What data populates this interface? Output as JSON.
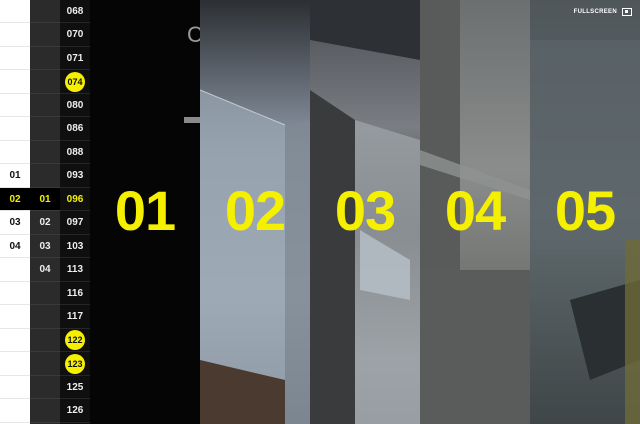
{
  "fullscreen": {
    "label": "FULLSCREEN",
    "icon": "fullscreen-icon"
  },
  "partial_heading": "C",
  "column_a": {
    "items": [
      {
        "label": ""
      },
      {
        "label": ""
      },
      {
        "label": ""
      },
      {
        "label": ""
      },
      {
        "label": ""
      },
      {
        "label": ""
      },
      {
        "label": ""
      },
      {
        "label": "01"
      },
      {
        "label": "02",
        "active": true
      },
      {
        "label": "03"
      },
      {
        "label": "04"
      },
      {
        "label": ""
      },
      {
        "label": ""
      },
      {
        "label": ""
      },
      {
        "label": ""
      },
      {
        "label": ""
      },
      {
        "label": ""
      },
      {
        "label": ""
      }
    ]
  },
  "column_b": {
    "items": [
      {
        "label": ""
      },
      {
        "label": ""
      },
      {
        "label": ""
      },
      {
        "label": ""
      },
      {
        "label": ""
      },
      {
        "label": ""
      },
      {
        "label": ""
      },
      {
        "label": ""
      },
      {
        "label": "01",
        "active": true
      },
      {
        "label": "02"
      },
      {
        "label": "03"
      },
      {
        "label": "04"
      },
      {
        "label": ""
      },
      {
        "label": ""
      },
      {
        "label": ""
      },
      {
        "label": ""
      },
      {
        "label": ""
      },
      {
        "label": ""
      }
    ]
  },
  "column_c": {
    "items": [
      {
        "label": "068"
      },
      {
        "label": "070"
      },
      {
        "label": "071"
      },
      {
        "label": "074",
        "highlight": true
      },
      {
        "label": "080"
      },
      {
        "label": "086"
      },
      {
        "label": "088"
      },
      {
        "label": "093"
      },
      {
        "label": "096",
        "active": true
      },
      {
        "label": "097"
      },
      {
        "label": "103"
      },
      {
        "label": "113"
      },
      {
        "label": "116"
      },
      {
        "label": "117"
      },
      {
        "label": "122",
        "highlight": true
      },
      {
        "label": "123",
        "highlight": true
      },
      {
        "label": "125"
      },
      {
        "label": "126"
      }
    ]
  },
  "slides": [
    {
      "number": "01"
    },
    {
      "number": "02"
    },
    {
      "number": "03"
    },
    {
      "number": "04"
    },
    {
      "number": "05"
    }
  ],
  "colors": {
    "accent": "#f5f000",
    "background": "#111111"
  }
}
